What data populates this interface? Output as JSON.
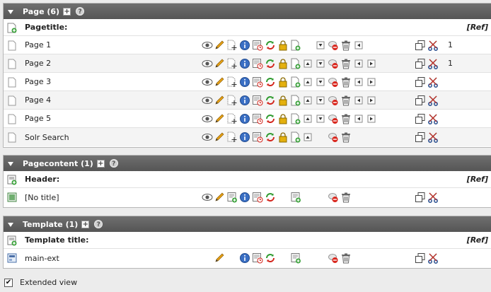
{
  "panels": [
    {
      "header": "Page (6)",
      "column_label": "Pagetitle:",
      "ref_label": "[Ref]",
      "rows": [
        {
          "title": "Page 1",
          "ref": "1"
        },
        {
          "title": "Page 2",
          "ref": "1"
        },
        {
          "title": "Page 3",
          "ref": ""
        },
        {
          "title": "Page 4",
          "ref": ""
        },
        {
          "title": "Page 5",
          "ref": ""
        },
        {
          "title": "Solr Search",
          "ref": ""
        }
      ]
    },
    {
      "header": "Pagecontent (1)",
      "column_label": "Header:",
      "ref_label": "[Ref]",
      "rows": [
        {
          "title": "[No title]",
          "ref": ""
        }
      ]
    },
    {
      "header": "Template (1)",
      "column_label": "Template title:",
      "ref_label": "[Ref]",
      "rows": [
        {
          "title": "main-ext",
          "ref": ""
        }
      ]
    }
  ],
  "footer": {
    "extended_view_label": "Extended view",
    "checked": true
  },
  "icons": {
    "colors": {
      "eye": "#555555",
      "pencil": "#e8a317",
      "info": "#3a6fc4",
      "lock": "#e4b00e",
      "new": "#3da33d",
      "refresh_green": "#2f9b2f",
      "refresh_red": "#d3261d",
      "delete": "#666666",
      "scissors": "#2a4f8f"
    }
  }
}
